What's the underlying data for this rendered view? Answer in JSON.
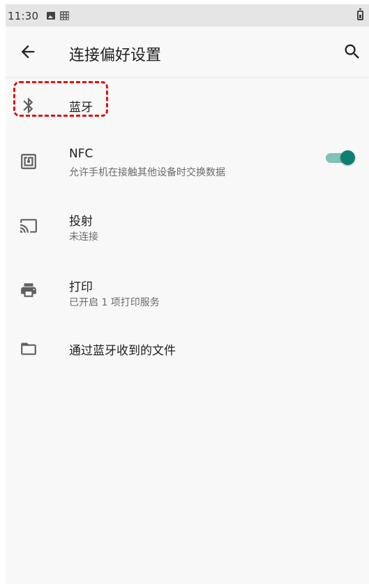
{
  "status_bar": {
    "time": "11:30"
  },
  "app_bar": {
    "title": "连接偏好设置"
  },
  "items": [
    {
      "title": "蓝牙",
      "subtitle": ""
    },
    {
      "title": "NFC",
      "subtitle": "允许手机在接触其他设备时交换数据",
      "toggle_on": true
    },
    {
      "title": "投射",
      "subtitle": "未连接"
    },
    {
      "title": "打印",
      "subtitle": "已开启 1 项打印服务"
    },
    {
      "title": "通过蓝牙收到的文件",
      "subtitle": ""
    }
  ],
  "colors": {
    "accent": "#0f7f70",
    "highlight": "#e01010"
  }
}
